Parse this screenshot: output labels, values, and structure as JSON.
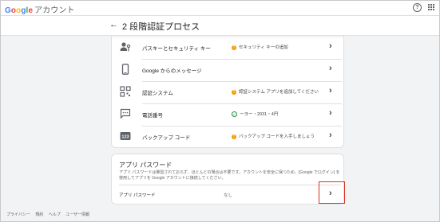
{
  "app": {
    "logo": {
      "g1": "G",
      "g2": "o",
      "g3": "o",
      "g4": "g",
      "g5": "l",
      "g6": "e"
    },
    "account_label": "アカウント"
  },
  "icons": {
    "help": "help-icon",
    "apps": "apps-grid-icon",
    "back": "back-arrow-icon"
  },
  "header": {
    "back_glyph": "←",
    "title": "2 段階認証プロセス"
  },
  "methods": [
    {
      "icon": "person-key-icon",
      "label": "パスキーとセキュリティ キー",
      "status": "セキュリティ キーの追加",
      "status_type": "warning"
    },
    {
      "icon": "phone-icon",
      "label": "Google からのメッセージ",
      "status": "",
      "status_type": "none"
    },
    {
      "icon": "qr-grid-icon",
      "label": "認証システム",
      "status": "認証システム アプリを追加してください",
      "status_type": "warning"
    },
    {
      "icon": "sms-icon",
      "label": "電話番号",
      "status": "ーヨー・2031・4円",
      "status_type": "ok"
    },
    {
      "icon": "backup-123-icon",
      "label": "バックアップ コード",
      "status": "バックアップ コードを入手しましょう",
      "status_type": "warning"
    }
  ],
  "app_passwords": {
    "title": "アプリ パスワード",
    "description": "アプリ パスワードは推奨されておらず、ほとんどの場合は不要です。アカウントを安全に保つため、[Google でログイン] を使用してアプリを Google アカウントに接続してください。",
    "row_label": "アプリ パスワード",
    "row_value": "なし"
  },
  "footer": [
    "プライバシー",
    "規約",
    "ヘルプ",
    "ユーザー情報"
  ],
  "colors": {
    "warning": "#f29900",
    "ok": "#1e8e3e",
    "highlight": "#d93025"
  }
}
